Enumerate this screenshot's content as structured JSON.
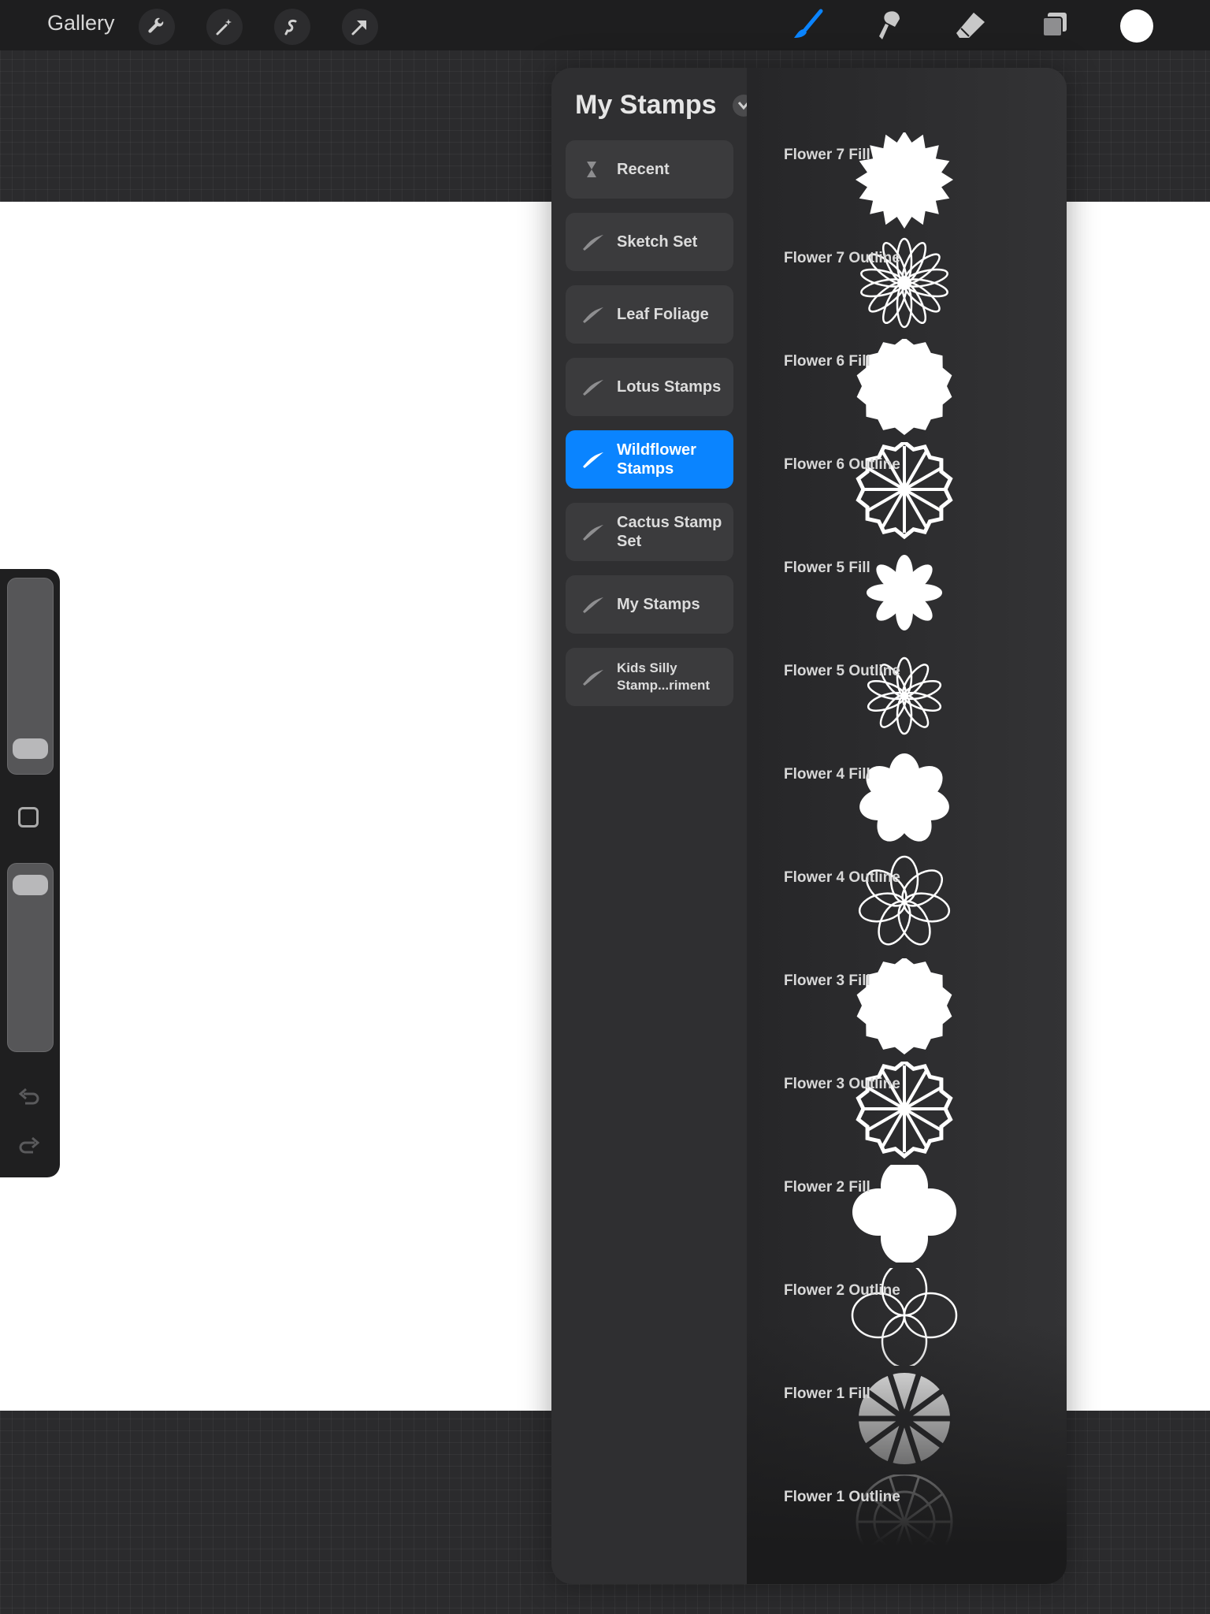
{
  "topbar": {
    "gallery_label": "Gallery",
    "tools": [
      "wrench-icon",
      "magic-wand-icon",
      "selection-icon",
      "transform-arrow-icon"
    ],
    "right_tools": [
      "brush-icon",
      "smudge-icon",
      "eraser-icon",
      "layers-icon",
      "color-swatch"
    ],
    "active_tool": "brush",
    "color": "#ffffff",
    "accent": "#0a84ff"
  },
  "panel": {
    "title": "My Stamps",
    "add_label": "+",
    "sets": [
      {
        "label": "Recent",
        "icon": "hourglass-icon"
      },
      {
        "label": "Sketch Set",
        "icon": "brush-stroke-icon"
      },
      {
        "label": "Leaf Foliage",
        "icon": "brush-stroke-icon"
      },
      {
        "label": "Lotus Stamps",
        "icon": "brush-stroke-icon"
      },
      {
        "label": "Wildflower Stamps",
        "icon": "brush-stroke-icon",
        "active": true
      },
      {
        "label": "Cactus Stamp Set",
        "icon": "brush-stroke-icon"
      },
      {
        "label": "My Stamps",
        "icon": "brush-stroke-icon"
      },
      {
        "label": "Kids Silly Stamp...riment",
        "icon": "brush-stroke-icon"
      }
    ],
    "brushes": [
      {
        "name": "Flower 7 Fill",
        "shape": "burst"
      },
      {
        "name": "Flower 7 Outline",
        "shape": "daisy-outline"
      },
      {
        "name": "Flower 6 Fill",
        "shape": "blob"
      },
      {
        "name": "Flower 6 Outline",
        "shape": "wheel-outline"
      },
      {
        "name": "Flower 5 Fill",
        "shape": "small-flower"
      },
      {
        "name": "Flower 5 Outline",
        "shape": "small-flower-outline"
      },
      {
        "name": "Flower 4 Fill",
        "shape": "petal-fill"
      },
      {
        "name": "Flower 4 Outline",
        "shape": "petal-outline"
      },
      {
        "name": "Flower 3 Fill",
        "shape": "blob"
      },
      {
        "name": "Flower 3 Outline",
        "shape": "wheel-outline"
      },
      {
        "name": "Flower 2 Fill",
        "shape": "four-petal"
      },
      {
        "name": "Flower 2 Outline",
        "shape": "four-petal-outline"
      },
      {
        "name": "Flower 1 Fill",
        "shape": "sun-fill"
      },
      {
        "name": "Flower 1 Outline",
        "shape": "sun-outline"
      }
    ]
  },
  "sidebar": {
    "brush_size_level": 0.06,
    "opacity_level": 0.96
  }
}
